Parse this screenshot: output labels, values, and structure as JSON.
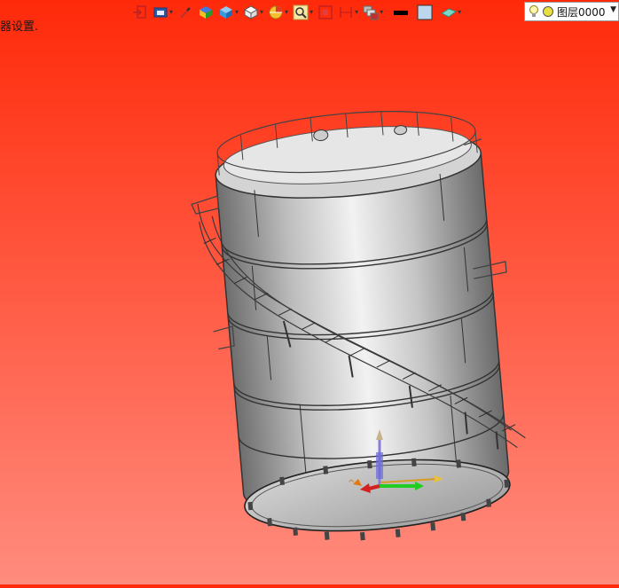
{
  "status": {
    "message": "器设置."
  },
  "toolbar": {
    "buttons": [
      {
        "name": "exit-sketch-icon",
        "has_dropdown": false
      },
      {
        "name": "view-mode-icon",
        "has_dropdown": true
      },
      {
        "name": "pen-icon",
        "has_dropdown": false
      },
      {
        "name": "color-material-icon",
        "has_dropdown": false
      },
      {
        "name": "shading-cube-icon",
        "has_dropdown": true
      },
      {
        "name": "wireframe-cube-icon",
        "has_dropdown": true
      },
      {
        "name": "section-view-icon",
        "has_dropdown": true
      },
      {
        "name": "zoom-icon",
        "has_dropdown": true
      },
      {
        "name": "fit-view-icon",
        "has_dropdown": false
      },
      {
        "name": "measure-icon",
        "has_dropdown": true
      },
      {
        "name": "layers-icon",
        "has_dropdown": true
      },
      {
        "name": "line-color-icon",
        "has_dropdown": false
      },
      {
        "name": "background-color-icon",
        "has_dropdown": false
      },
      {
        "name": "plane-icon",
        "has_dropdown": true
      }
    ],
    "colors": {
      "line": "#000000",
      "background": "#bcd6ee"
    }
  },
  "layer": {
    "name": "图层0000",
    "bulb_icon": "lightbulb-icon",
    "state_icon": "yellow-circle-icon"
  },
  "viewport": {
    "background_top": "#ff2a0a",
    "background_bottom": "#ff8c7e",
    "model": "cylindrical-storage-tank"
  }
}
